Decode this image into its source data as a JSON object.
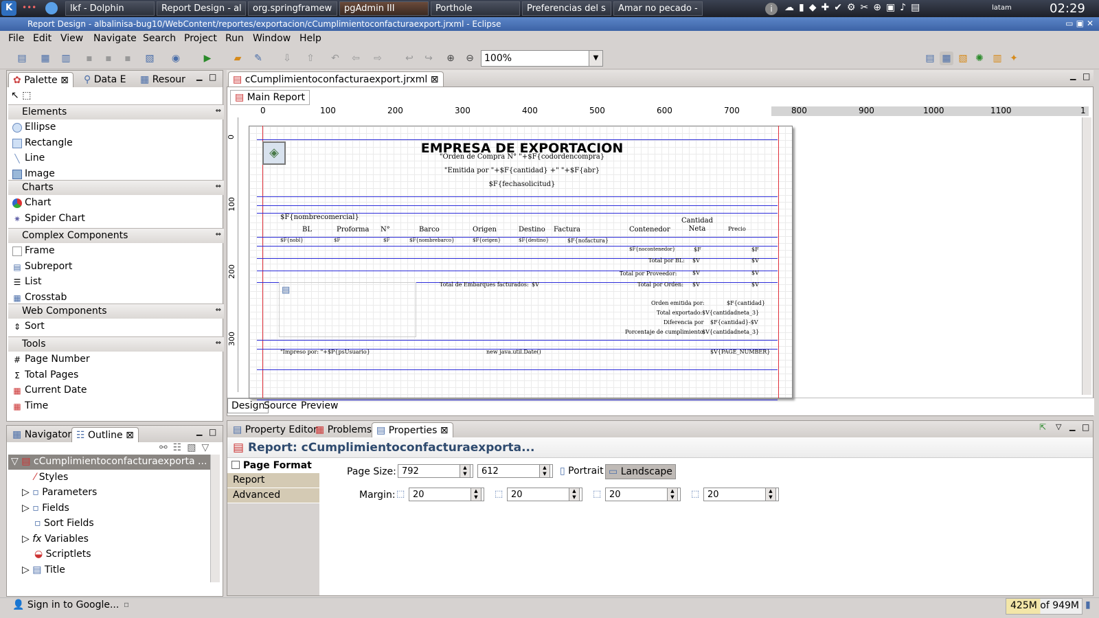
{
  "taskbar": {
    "tasks": [
      "lkf - Dolphin",
      "Report Design - al",
      "org.springframew",
      "pgAdmin III",
      "Porthole",
      "Preferencias del s",
      "Amar no pecado -"
    ],
    "layout_label": "latam",
    "clock": "02:29"
  },
  "window": {
    "title": "Report Design - albalinisa-bug10/WebContent/reportes/exportacion/cCumplimientoconfacturaexport.jrxml - Eclipse"
  },
  "menu": [
    "File",
    "Edit",
    "View",
    "Navigate",
    "Search",
    "Project",
    "Run",
    "Window",
    "Help"
  ],
  "toolbar": {
    "zoom": "100%"
  },
  "left_tabs": [
    "Palette",
    "Data E",
    "Resour"
  ],
  "palette": {
    "sections": [
      {
        "title": "Elements",
        "items": [
          "Ellipse",
          "Rectangle",
          "Line",
          "Image"
        ]
      },
      {
        "title": "Charts",
        "items": [
          "Chart",
          "Spider Chart"
        ]
      },
      {
        "title": "Complex Components",
        "items": [
          "Frame",
          "Subreport",
          "List",
          "Crosstab"
        ]
      },
      {
        "title": "Web Components",
        "items": [
          "Sort"
        ]
      },
      {
        "title": "Tools",
        "items": [
          "Page Number",
          "Total Pages",
          "Current Date",
          "Time"
        ]
      }
    ]
  },
  "bottom_left_tabs": [
    "Navigator",
    "Outline"
  ],
  "outline": {
    "root": "cCumplimientoconfacturaexporta ...",
    "items": [
      "Styles",
      "Parameters",
      "Fields",
      "Sort Fields",
      "Variables",
      "Scriptlets",
      "Title"
    ]
  },
  "editor": {
    "file_tab": "cCumplimientoconfacturaexport.jrxml",
    "subtab": "Main Report",
    "ruler": [
      "0",
      "100",
      "200",
      "300",
      "400",
      "500",
      "600",
      "700",
      "800",
      "900",
      "1000",
      "1100",
      "1"
    ],
    "vruler": [
      "0",
      "100",
      "200",
      "300"
    ],
    "mode_tabs": [
      "Design",
      "Source",
      "Preview"
    ]
  },
  "report": {
    "title": "EMPRESA DE EXPORTACION",
    "order": "\"Orden de Compra N° \"+$F{codordencompra}",
    "emitida": "\"Emitida por \"+$F{cantidad} +\" \"+$F{abr}",
    "fecha": "$F{fechasolicitud}",
    "nombre": "$F{nombrecomercial}",
    "headers": [
      "BL",
      "Proforma",
      "N°",
      "Barco",
      "Origen",
      "Destino",
      "Factura",
      "Contenedor",
      "Cantidad Neta",
      "Precio"
    ],
    "detail": [
      "$F{nobl}",
      "$F",
      "$F",
      "$F{nombrebarco}",
      "$F{origen}",
      "$F{destino}",
      "$F{nofactura}"
    ],
    "contenedor": "$F{nocontenedor}",
    "f1": "$F",
    "f2": "$F",
    "total_bl": "Total por BL:",
    "total_proveedor": "Total por Proveedor:",
    "total_orden": "Total por Orden:",
    "v": "$V",
    "total_embarques": "Total de Embarques facturados:",
    "orden_emitida": "Orden emitida por:",
    "orden_emitida_val": "$F{cantidad}",
    "total_exportado": "Total exportado:",
    "total_exportado_val": "$V{cantidadneta_3}",
    "diferencia": "Diferencia por",
    "diferencia_val": "$F{cantidad}-$V",
    "porcentaje": "Porcentaje de cumplimiento:",
    "porcentaje_val": "$V{cantidadneta_3}",
    "impreso": "\"Impreso por: \"+$P{psUsuario}",
    "date": "new java.util.Date()",
    "page_number": "$V{PAGE_NUMBER}"
  },
  "bottom_tabs": [
    "Property Editor",
    "Problems",
    "Properties"
  ],
  "properties": {
    "heading": "Report: cCumplimientoconfacturaexporta...",
    "sections": [
      "Page Format",
      "Report",
      "Advanced"
    ],
    "page_size_label": "Page Size:",
    "width": "792",
    "height": "612",
    "portrait": "Portrait",
    "landscape": "Landscape",
    "margin_label": "Margin:",
    "margins": [
      "20",
      "20",
      "20",
      "20"
    ]
  },
  "status": {
    "signin": "Sign in to Google...",
    "heap": "425M of 949M"
  }
}
